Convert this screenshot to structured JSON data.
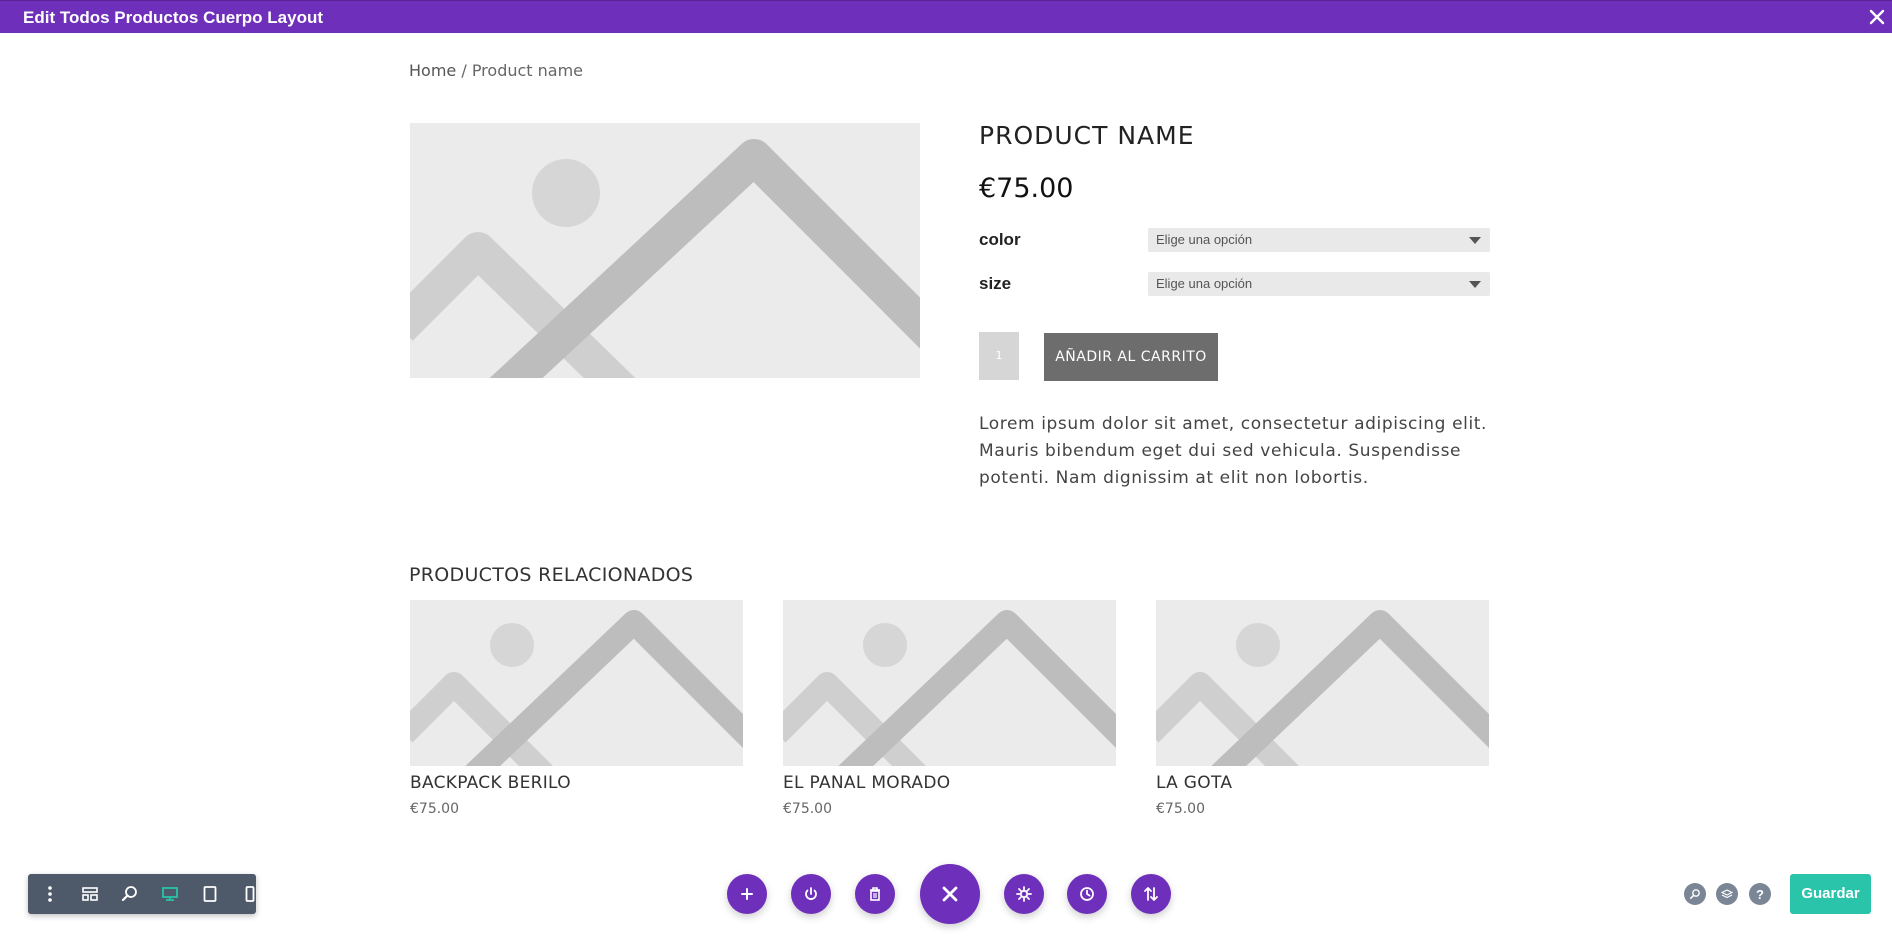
{
  "window": {
    "title": "Edit Todos Productos Cuerpo Layout"
  },
  "breadcrumb": {
    "home": "Home",
    "separator": " / ",
    "current": "Product name"
  },
  "product": {
    "title": "PRODUCT NAME",
    "price": "€75.00",
    "options": [
      {
        "label": "color",
        "placeholder": "Elige una opción"
      },
      {
        "label": "size",
        "placeholder": "Elige una opción"
      }
    ],
    "quantity": "1",
    "add_to_cart": "AÑADIR AL CARRITO",
    "description": "Lorem ipsum dolor sit amet, consectetur adipiscing elit. Mauris bibendum eget dui sed vehicula. Suspendisse potenti. Nam dignissim at elit non lobortis."
  },
  "related": {
    "title": "PRODUCTOS RELACIONADOS",
    "items": [
      {
        "name": "BACKPACK BERILO",
        "price": "€75.00"
      },
      {
        "name": "EL PANAL MORADO",
        "price": "€75.00"
      },
      {
        "name": "LA GOTA",
        "price": "€75.00"
      }
    ]
  },
  "builder_toolbar": {
    "left_icons": [
      "more-vertical-icon",
      "wireframe-icon",
      "zoom-icon",
      "desktop-icon",
      "tablet-icon",
      "phone-icon"
    ],
    "center_icons": [
      "add-icon",
      "power-icon",
      "trash-icon",
      "close-icon",
      "gear-icon",
      "history-icon",
      "portability-icon"
    ],
    "right_icons": [
      "search-icon",
      "layers-icon",
      "help-icon"
    ],
    "help_glyph": "?",
    "save_label": "Guardar"
  },
  "colors": {
    "accent": "#6e2fba",
    "save": "#29c4a9",
    "toolbar": "#4e5a6a",
    "active_view": "#29c4a9",
    "placeholder_bg": "#ebebeb",
    "placeholder_shape": "#bdbdbd"
  }
}
